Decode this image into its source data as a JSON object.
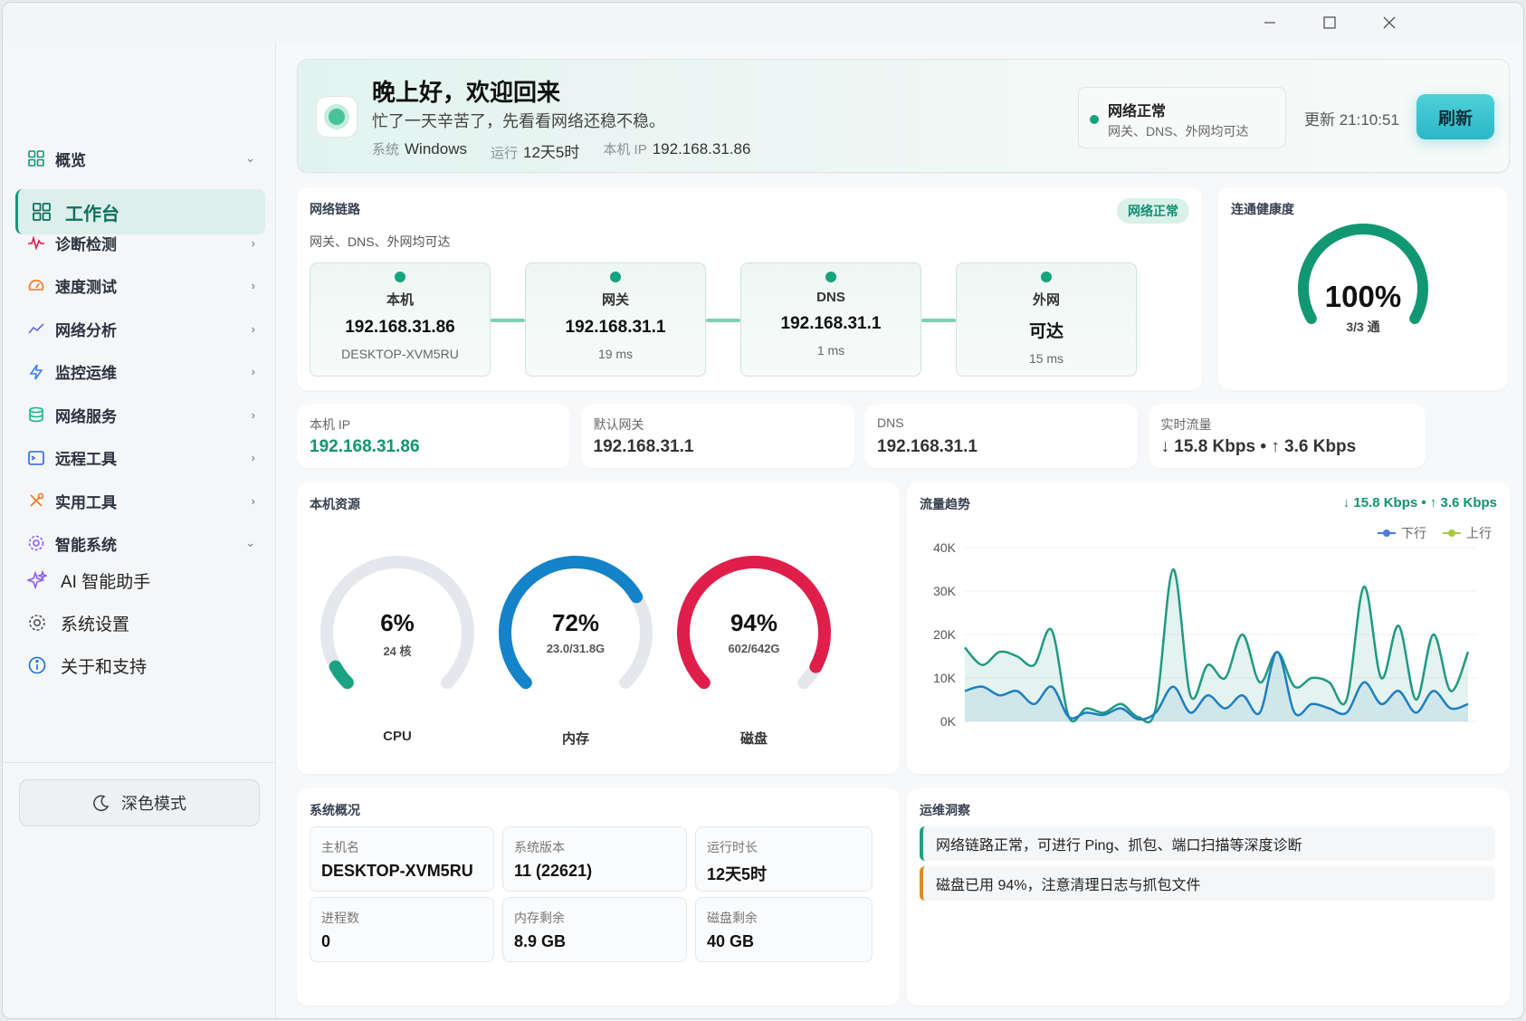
{
  "sidebar": {
    "overview_label": "概览",
    "workbench_label": "工作台",
    "groups": [
      {
        "label": "诊断检测",
        "icon": "pulse-icon"
      },
      {
        "label": "速度测试",
        "icon": "speedometer-icon"
      },
      {
        "label": "网络分析",
        "icon": "trend-icon"
      },
      {
        "label": "监控运维",
        "icon": "bolt-icon"
      },
      {
        "label": "网络服务",
        "icon": "database-icon"
      },
      {
        "label": "远程工具",
        "icon": "terminal-icon"
      },
      {
        "label": "实用工具",
        "icon": "tools-icon"
      }
    ],
    "smart_label": "智能系统",
    "sub_items": [
      {
        "label": "AI 智能助手",
        "icon": "sparkle-icon"
      },
      {
        "label": "系统设置",
        "icon": "gear-icon"
      },
      {
        "label": "关于和支持",
        "icon": "info-icon"
      }
    ],
    "dark_mode_label": "深色模式"
  },
  "hero": {
    "title": "晚上好，欢迎回来",
    "subtitle": "忙了一天辛苦了，先看看网络还稳不稳。",
    "meta": [
      {
        "key": "系统",
        "value": "Windows"
      },
      {
        "key": "运行",
        "value": "12天5时"
      },
      {
        "key": "本机 IP",
        "value": "192.168.31.86"
      }
    ],
    "status_title": "网络正常",
    "status_desc": "网关、DNS、外网均可达",
    "update_text": "更新 21:10:51",
    "refresh_label": "刷新"
  },
  "link": {
    "title": "网络链路",
    "badge": "网络正常",
    "subtitle": "网关、DNS、外网均可达",
    "nodes": [
      {
        "name": "本机",
        "value": "192.168.31.86",
        "sub": "DESKTOP-XVM5RU"
      },
      {
        "name": "网关",
        "value": "192.168.31.1",
        "sub": "19 ms"
      },
      {
        "name": "DNS",
        "value": "192.168.31.1",
        "sub": "1 ms"
      },
      {
        "name": "外网",
        "value": "可达",
        "sub": "15 ms"
      }
    ]
  },
  "health": {
    "title": "连通健康度",
    "value": "100%",
    "sub": "3/3 通",
    "fraction": 1.0
  },
  "info": [
    {
      "key": "本机 IP",
      "value": "192.168.31.86",
      "color": "#12946f"
    },
    {
      "key": "默认网关",
      "value": "192.168.31.1",
      "color": "#333333"
    },
    {
      "key": "DNS",
      "value": "192.168.31.1",
      "color": "#333333"
    },
    {
      "key": "实时流量",
      "value": "↓ 15.8 Kbps • ↑ 3.6 Kbps",
      "color": "#333333"
    }
  ],
  "resources": {
    "title": "本机资源",
    "gauges": [
      {
        "value": "6%",
        "sub": "24 核",
        "label": "CPU",
        "fraction": 0.06,
        "color": "#19a382"
      },
      {
        "value": "72%",
        "sub": "23.0/31.8G",
        "label": "内存",
        "fraction": 0.72,
        "color": "#1483c9"
      },
      {
        "value": "94%",
        "sub": "602/642G",
        "label": "磁盘",
        "fraction": 0.94,
        "color": "#e01e4a"
      }
    ]
  },
  "trend": {
    "title": "流量趋势",
    "current": "↓ 15.8 Kbps • ↑ 3.6 Kbps",
    "legend_down": "下行",
    "legend_up": "上行",
    "down_color": "#4f7bd6",
    "up_color": "#a6cc3a"
  },
  "chart_data": {
    "type": "area",
    "yticks": [
      "40K",
      "30K",
      "20K",
      "10K",
      "0K"
    ],
    "ylim": [
      0,
      40000
    ],
    "series": [
      {
        "name": "下行",
        "values": [
          17000,
          13000,
          16000,
          15000,
          13000,
          21000,
          1000,
          3000,
          2000,
          4000,
          1000,
          3000,
          35000,
          6000,
          13000,
          10000,
          20000,
          9000,
          16000,
          8000,
          10000,
          9000,
          5000,
          31000,
          10000,
          22000,
          5000,
          20000,
          7000,
          16000
        ]
      },
      {
        "name": "上行",
        "values": [
          7000,
          8000,
          6000,
          7000,
          4000,
          8000,
          1000,
          2000,
          1500,
          3000,
          500,
          2000,
          8000,
          2000,
          6000,
          3000,
          6000,
          2000,
          16000,
          2000,
          4000,
          3000,
          2000,
          9000,
          4000,
          7000,
          2000,
          7000,
          3000,
          4000
        ]
      }
    ]
  },
  "system": {
    "title": "系统概况",
    "items": [
      {
        "key": "主机名",
        "value": "DESKTOP-XVM5RU"
      },
      {
        "key": "系统版本",
        "value": "11 (22621)"
      },
      {
        "key": "运行时长",
        "value": "12天5时"
      },
      {
        "key": "进程数",
        "value": "0"
      },
      {
        "key": "内存剩余",
        "value": "8.9 GB"
      },
      {
        "key": "磁盘剩余",
        "value": "40 GB"
      }
    ]
  },
  "ops": {
    "title": "运维洞察",
    "items": [
      {
        "text": "网络链路正常，可进行 Ping、抓包、端口扫描等深度诊断",
        "level": "ok"
      },
      {
        "text": "磁盘已用 94%，注意清理日志与抓包文件",
        "level": "warn"
      }
    ]
  }
}
